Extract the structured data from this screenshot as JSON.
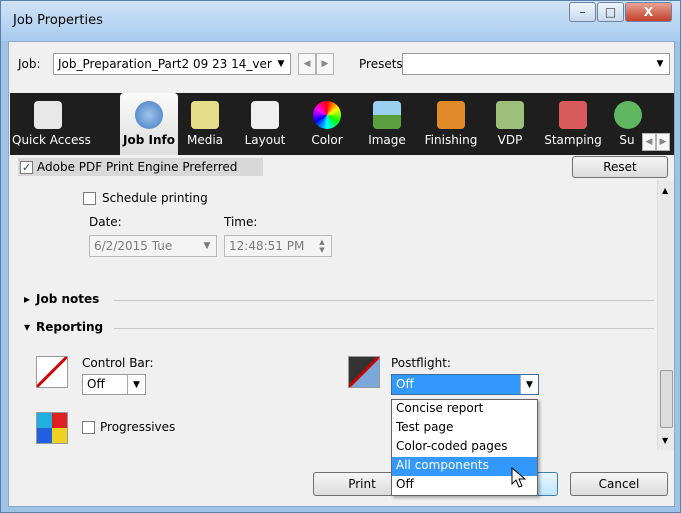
{
  "window": {
    "title": "Job Properties",
    "minimize": "–",
    "maximize": "□",
    "close": "X"
  },
  "header": {
    "job_label": "Job:",
    "job_value": "Job_Preparation_Part2 09 23 14_ver",
    "presets_label": "Presets:",
    "presets_value": ""
  },
  "tabs": [
    {
      "label": "Quick Access",
      "icon": "quick-access-icon"
    },
    {
      "label": "Job Info",
      "icon": "info-icon",
      "active": true
    },
    {
      "label": "Media",
      "icon": "media-icon"
    },
    {
      "label": "Layout",
      "icon": "layout-icon"
    },
    {
      "label": "Color",
      "icon": "color-wheel-icon"
    },
    {
      "label": "Image",
      "icon": "image-icon"
    },
    {
      "label": "Finishing",
      "icon": "finishing-icon"
    },
    {
      "label": "VDP",
      "icon": "vdp-icon"
    },
    {
      "label": "Stamping",
      "icon": "stamping-icon"
    },
    {
      "label": "Su",
      "icon": "check-icon"
    }
  ],
  "toolbar_bar": {
    "pdf_checkbox_label": "Adobe PDF Print Engine Preferred",
    "pdf_checked": true,
    "reset_label": "Reset"
  },
  "schedule": {
    "label": "Schedule printing",
    "date_label": "Date:",
    "date_value": "6/2/2015 Tue",
    "time_label": "Time:",
    "time_value": "12:48:51 PM"
  },
  "sections": {
    "job_notes": "Job notes",
    "reporting": "Reporting"
  },
  "reporting": {
    "control_bar_label": "Control Bar:",
    "control_bar_value": "Off",
    "postflight_label": "Postflight:",
    "postflight_value": "Off",
    "progressives_label": "Progressives",
    "postflight_options": [
      "Concise report",
      "Test page",
      "Color-coded pages",
      "All components",
      "Off"
    ],
    "highlighted_option": "All components"
  },
  "footer": {
    "print_label": "Print",
    "cancel_label": "Cancel"
  },
  "colors": {
    "accent": "#3399ff",
    "toolbar_bg": "#1e1e1e",
    "window_frame": "#9fc3e6"
  }
}
